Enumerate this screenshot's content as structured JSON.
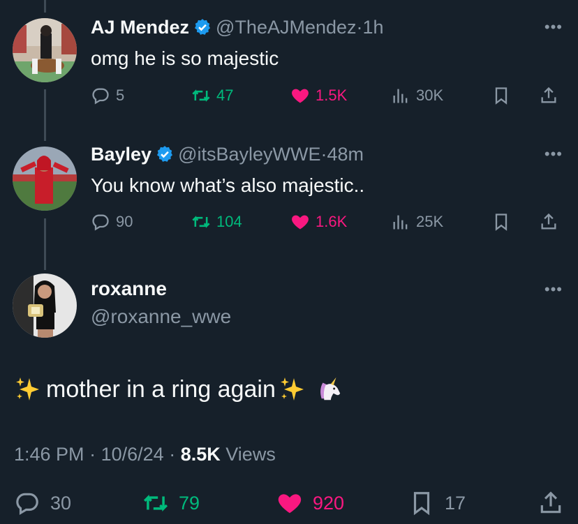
{
  "tweets": [
    {
      "name": "AJ Mendez",
      "handle": "@TheAJMendez",
      "time": "1h",
      "text": "omg he is so majestic",
      "replies": "5",
      "retweets": "47",
      "likes": "1.5K",
      "views": "30K"
    },
    {
      "name": "Bayley",
      "handle": "@itsBayleyWWE",
      "time": "48m",
      "text": "You know what’s also majestic..",
      "replies": "90",
      "retweets": "104",
      "likes": "1.6K",
      "views": "25K"
    }
  ],
  "main": {
    "name": "roxanne",
    "handle": "@roxanne_wwe",
    "text": "mother in a ring again",
    "time": "1:46 PM",
    "date": "10/6/24",
    "views_count": "8.5K",
    "views_label": "Views",
    "replies": "30",
    "retweets": "79",
    "likes": "920",
    "bookmarks": "17"
  },
  "icons": {
    "verified": "verified-badge-icon",
    "reply": "reply-icon",
    "retweet": "retweet-icon",
    "like": "heart-icon",
    "views": "analytics-icon",
    "bookmark": "bookmark-icon",
    "share": "share-icon",
    "more": "more-dots-icon",
    "sparkles": "sparkles-emoji",
    "unicorn": "unicorn-emoji"
  },
  "colors": {
    "background": "#16202a",
    "text": "#f7f9f9",
    "muted": "#8b98a5",
    "retweet": "#00ba7c",
    "like": "#f91880",
    "verified": "#1d9bf0"
  }
}
